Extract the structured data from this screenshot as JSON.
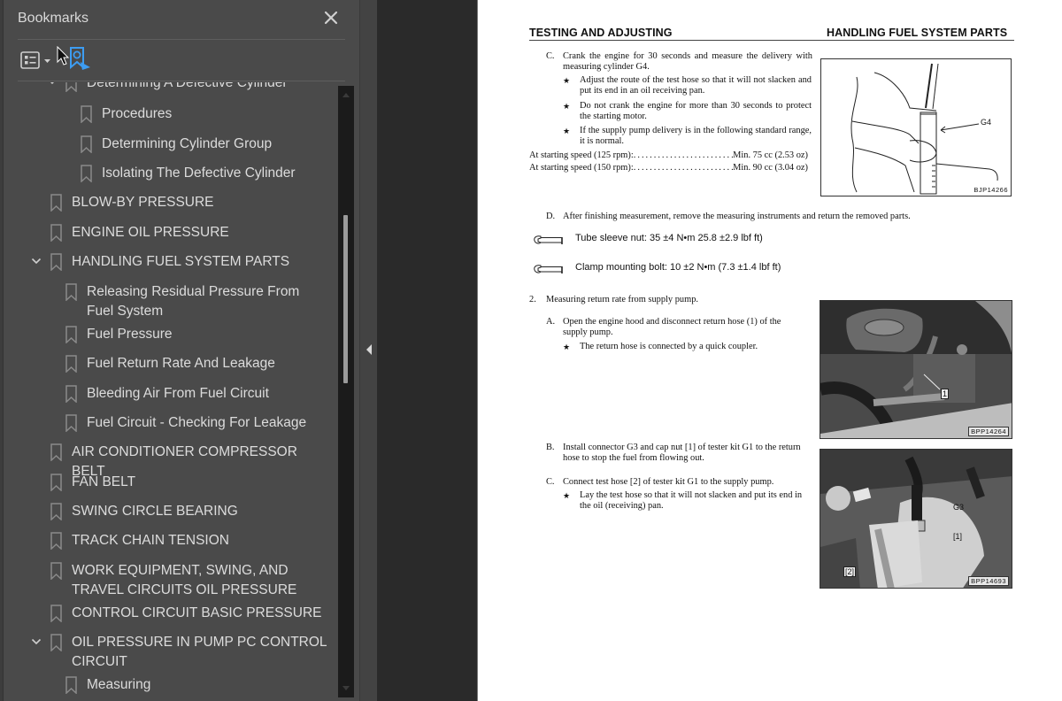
{
  "bookmarks_panel": {
    "title": "Bookmarks",
    "close_icon": "close-icon",
    "options_icon": "list-options-icon",
    "find_bookmark_icon": "find-current-bookmark-icon",
    "accent_color": "#3d9df2",
    "items": [
      {
        "label": "Determining A Defective Cylinder",
        "level": 3,
        "expanded": true,
        "partially_visible": true
      },
      {
        "label": "Procedures",
        "level": 4
      },
      {
        "label": "Determining Cylinder Group",
        "level": 4
      },
      {
        "label": "Isolating The Defective Cylinder",
        "level": 4
      },
      {
        "label": "BLOW-BY PRESSURE",
        "level": 2
      },
      {
        "label": "ENGINE OIL PRESSURE",
        "level": 2
      },
      {
        "label": "HANDLING FUEL SYSTEM PARTS",
        "level": 2,
        "expanded": true
      },
      {
        "label": "Releasing Residual Pressure From Fuel System",
        "level": 3
      },
      {
        "label": "Fuel Pressure",
        "level": 3
      },
      {
        "label": "Fuel Return Rate And Leakage",
        "level": 3
      },
      {
        "label": "Bleeding Air From Fuel Circuit",
        "level": 3
      },
      {
        "label": "Fuel Circuit - Checking For Leakage",
        "level": 3
      },
      {
        "label": "AIR CONDITIONER COMPRESSOR BELT",
        "level": 2
      },
      {
        "label": "FAN BELT",
        "level": 2
      },
      {
        "label": "SWING CIRCLE BEARING",
        "level": 2
      },
      {
        "label": "TRACK CHAIN TENSION",
        "level": 2
      },
      {
        "label": "WORK EQUIPMENT, SWING, AND TRAVEL CIRCUITS OIL PRESSURE",
        "level": 2
      },
      {
        "label": "CONTROL CIRCUIT BASIC PRESSURE",
        "level": 2
      },
      {
        "label": "OIL PRESSURE IN PUMP PC CONTROL CIRCUIT",
        "level": 2,
        "expanded": true
      },
      {
        "label": "Measuring",
        "level": 3
      }
    ]
  },
  "document": {
    "header_left": "TESTING AND ADJUSTING",
    "header_right": "HANDLING FUEL SYSTEM PARTS",
    "step_c1": {
      "marker": "C.",
      "text": "Crank the engine for 30 seconds and measure the delivery with measuring cylinder G4.",
      "notes": [
        "Adjust the route of the test hose so that it will not slacken and put its end in an oil receiving pan.",
        "Do not crank the engine for more than 30 seconds to protect the starting motor.",
        "If the supply pump delivery is in the following standard range, it is normal."
      ]
    },
    "specs": [
      {
        "label": "At starting speed (125 rpm):",
        "value": "Min. 75 cc (2.53 oz)"
      },
      {
        "label": "At starting speed (150 rpm):",
        "value": "Min. 90 cc (3.04 oz)"
      }
    ],
    "figure1": {
      "callout": "G4",
      "code": "BJP14266"
    },
    "step_d": {
      "marker": "D.",
      "text": "After finishing measurement, remove the measuring instruments and return the removed parts."
    },
    "torques": [
      {
        "icon": "torque-wrench-icon",
        "text": "Tube sleeve nut: 35 ±4 N•m 25.8 ±2.9 lbf ft)"
      },
      {
        "icon": "torque-wrench-icon",
        "text": "Clamp mounting bolt: 10 ±2 N•m (7.3 ±1.4 lbf ft)"
      }
    ],
    "section2": {
      "marker": "2.",
      "text": "Measuring return rate from supply pump."
    },
    "step_a": {
      "marker": "A.",
      "text": "Open the engine hood and disconnect return hose (1) of the supply pump.",
      "note": "The return hose is connected by a quick coupler."
    },
    "figure2": {
      "callout": "1",
      "code": "BPP14264"
    },
    "step_b": {
      "marker": "B.",
      "text": "Install connector G3 and cap nut [1] of tester kit G1 to the return hose to stop the fuel from flowing out."
    },
    "step_c2": {
      "marker": "C.",
      "text": "Connect test hose [2] of tester kit G1 to the supply pump.",
      "note": "Lay the test hose so that it will not slacken and put its end in the oil (receiving) pan."
    },
    "figure3": {
      "callouts": [
        "G3",
        "[1]",
        "[2]"
      ],
      "code": "BPP14693"
    },
    "star_glyph": "★"
  }
}
